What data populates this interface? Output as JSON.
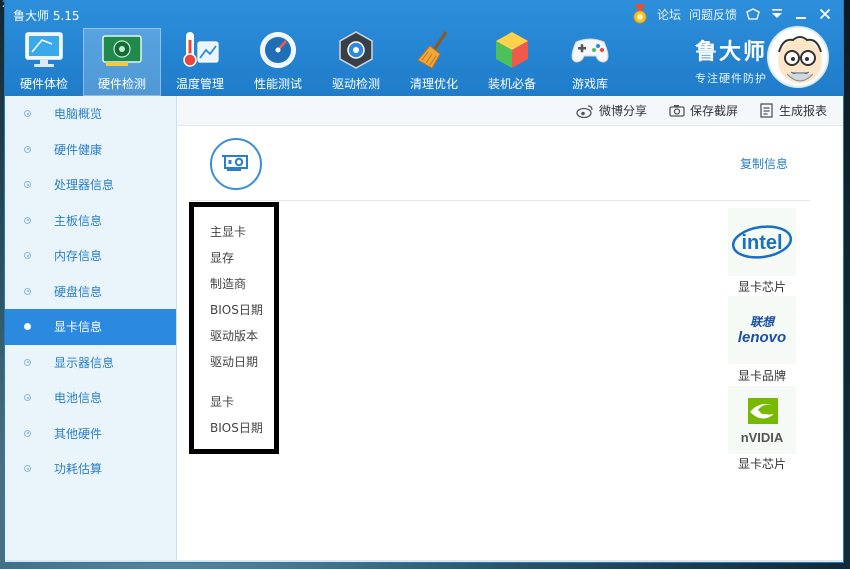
{
  "app": {
    "title": "鲁大师 5.15",
    "forum_link": "论坛",
    "feedback_link": "问题反馈",
    "brand_name": "鲁大师",
    "brand_slogan": "专注硬件防护"
  },
  "nav": {
    "items": [
      {
        "label": "硬件体检"
      },
      {
        "label": "硬件检测"
      },
      {
        "label": "温度管理"
      },
      {
        "label": "性能测试"
      },
      {
        "label": "驱动检测"
      },
      {
        "label": "清理优化"
      },
      {
        "label": "装机必备"
      },
      {
        "label": "游戏库"
      }
    ],
    "active_index": 1
  },
  "sidebar": {
    "items": [
      {
        "label": "电脑概览"
      },
      {
        "label": "硬件健康"
      },
      {
        "label": "处理器信息"
      },
      {
        "label": "主板信息"
      },
      {
        "label": "内存信息"
      },
      {
        "label": "硬盘信息"
      },
      {
        "label": "显卡信息"
      },
      {
        "label": "显示器信息"
      },
      {
        "label": "电池信息"
      },
      {
        "label": "其他硬件"
      },
      {
        "label": "功耗估算"
      }
    ],
    "active_index": 6
  },
  "toolbar": {
    "weibo_share": "微博分享",
    "save_screenshot": "保存截屏",
    "generate_report": "生成报表"
  },
  "main": {
    "copy_info": "复制信息",
    "rows": [
      "主显卡",
      "显存",
      "制造商",
      "BIOS日期",
      "驱动版本",
      "驱动日期",
      "显卡",
      "BIOS日期"
    ],
    "logos": [
      {
        "name": "intel-logo",
        "text": "intel",
        "caption": "显卡芯片"
      },
      {
        "name": "lenovo-logo",
        "text_top": "联想",
        "text": "lenovo",
        "caption": "显卡品牌"
      },
      {
        "name": "nvidia-logo",
        "text": "nVIDIA",
        "caption": "显卡芯片"
      }
    ]
  },
  "colors": {
    "header_blue": "#1f7cc9",
    "accent_blue": "#2b8ae0",
    "link_blue": "#2a7fc6"
  }
}
